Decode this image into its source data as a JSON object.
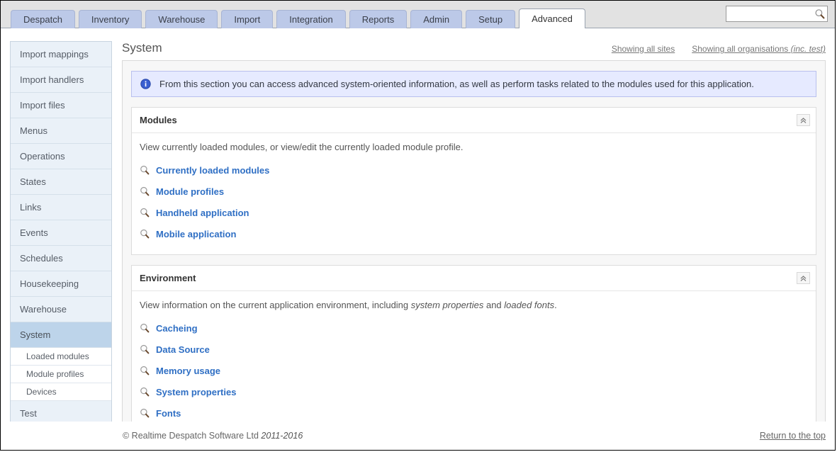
{
  "tabs": [
    {
      "label": "Despatch",
      "active": false
    },
    {
      "label": "Inventory",
      "active": false
    },
    {
      "label": "Warehouse",
      "active": false
    },
    {
      "label": "Import",
      "active": false
    },
    {
      "label": "Integration",
      "active": false
    },
    {
      "label": "Reports",
      "active": false
    },
    {
      "label": "Admin",
      "active": false
    },
    {
      "label": "Setup",
      "active": false
    },
    {
      "label": "Advanced",
      "active": true
    }
  ],
  "search": {
    "value": "",
    "placeholder": "",
    "icon": "search-icon"
  },
  "sidebar": {
    "items": [
      {
        "label": "Import mappings",
        "selected": false,
        "sub": false
      },
      {
        "label": "Import handlers",
        "selected": false,
        "sub": false
      },
      {
        "label": "Import files",
        "selected": false,
        "sub": false
      },
      {
        "label": "Menus",
        "selected": false,
        "sub": false
      },
      {
        "label": "Operations",
        "selected": false,
        "sub": false
      },
      {
        "label": "States",
        "selected": false,
        "sub": false
      },
      {
        "label": "Links",
        "selected": false,
        "sub": false
      },
      {
        "label": "Events",
        "selected": false,
        "sub": false
      },
      {
        "label": "Schedules",
        "selected": false,
        "sub": false
      },
      {
        "label": "Housekeeping",
        "selected": false,
        "sub": false
      },
      {
        "label": "Warehouse",
        "selected": false,
        "sub": false
      },
      {
        "label": "System",
        "selected": true,
        "sub": false
      },
      {
        "label": "Loaded modules",
        "selected": false,
        "sub": true
      },
      {
        "label": "Module profiles",
        "selected": false,
        "sub": true
      },
      {
        "label": "Devices",
        "selected": false,
        "sub": true
      },
      {
        "label": "Test",
        "selected": false,
        "sub": false
      }
    ]
  },
  "header": {
    "title": "System",
    "links": [
      {
        "label": "Showing all sites",
        "italic_suffix": ""
      },
      {
        "label": "Showing all organisations",
        "italic_suffix": "(inc. test)"
      }
    ]
  },
  "infobar": {
    "icon": "info-icon",
    "text": "From this section you can access advanced system-oriented information, as well as perform tasks related to the modules used for this application."
  },
  "panels": [
    {
      "title": "Modules",
      "collapse_icon": "chevron-double-up-icon",
      "description_parts": [
        {
          "text": "View currently loaded modules, or view/edit the currently loaded module profile.",
          "italic": false
        }
      ],
      "links": [
        {
          "label": "Currently loaded modules",
          "icon": "magnifier-icon"
        },
        {
          "label": "Module profiles",
          "icon": "magnifier-icon"
        },
        {
          "label": "Handheld application",
          "icon": "magnifier-icon"
        },
        {
          "label": "Mobile application",
          "icon": "magnifier-icon"
        }
      ]
    },
    {
      "title": "Environment",
      "collapse_icon": "chevron-double-up-icon",
      "description_parts": [
        {
          "text": "View information on the current application environment, including ",
          "italic": false
        },
        {
          "text": "system properties",
          "italic": true
        },
        {
          "text": " and ",
          "italic": false
        },
        {
          "text": "loaded fonts",
          "italic": true
        },
        {
          "text": ".",
          "italic": false
        }
      ],
      "links": [
        {
          "label": "Cacheing",
          "icon": "magnifier-icon"
        },
        {
          "label": "Data Source",
          "icon": "magnifier-icon"
        },
        {
          "label": "Memory usage",
          "icon": "magnifier-icon"
        },
        {
          "label": "System properties",
          "icon": "magnifier-icon"
        },
        {
          "label": "Fonts",
          "icon": "magnifier-icon"
        }
      ]
    }
  ],
  "footer": {
    "copyright": "© Realtime Despatch Software Ltd",
    "years": "2011-2016",
    "return_link": "Return to the top"
  },
  "colors": {
    "tab_inactive": "#bcc9e8",
    "tab_active": "#ffffff",
    "sidebar_item": "#eaf1f8",
    "sidebar_selected": "#bdd4ea",
    "link_blue": "#2f6fc4",
    "info_bg": "#e6eaff",
    "info_border": "#b9c0ee",
    "content_bg": "#f7f7f7"
  }
}
